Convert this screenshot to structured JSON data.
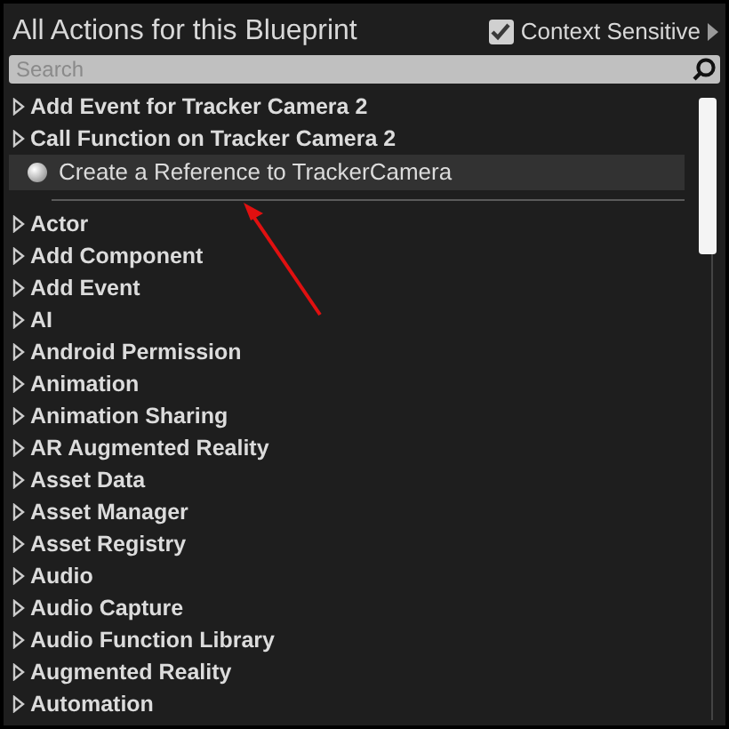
{
  "title": "All Actions for this Blueprint",
  "context_sensitive": {
    "label": "Context Sensitive",
    "checked": true
  },
  "search": {
    "placeholder": "Search"
  },
  "context_items": [
    {
      "kind": "category",
      "label": "Add Event for Tracker Camera 2",
      "selected": false
    },
    {
      "kind": "category",
      "label": "Call Function on Tracker Camera 2",
      "selected": false
    },
    {
      "kind": "action",
      "label": "Create a Reference to TrackerCamera",
      "selected": true
    }
  ],
  "categories": [
    {
      "kind": "category",
      "label": "Actor",
      "selected": false
    },
    {
      "kind": "category",
      "label": "Add Component",
      "selected": false
    },
    {
      "kind": "category",
      "label": "Add Event",
      "selected": false
    },
    {
      "kind": "category",
      "label": "AI",
      "selected": false
    },
    {
      "kind": "category",
      "label": "Android Permission",
      "selected": false
    },
    {
      "kind": "category",
      "label": "Animation",
      "selected": false
    },
    {
      "kind": "category",
      "label": "Animation Sharing",
      "selected": false
    },
    {
      "kind": "category",
      "label": "AR Augmented Reality",
      "selected": false
    },
    {
      "kind": "category",
      "label": "Asset Data",
      "selected": false
    },
    {
      "kind": "category",
      "label": "Asset Manager",
      "selected": false
    },
    {
      "kind": "category",
      "label": "Asset Registry",
      "selected": false
    },
    {
      "kind": "category",
      "label": "Audio",
      "selected": false
    },
    {
      "kind": "category",
      "label": "Audio Capture",
      "selected": false
    },
    {
      "kind": "category",
      "label": "Audio Function Library",
      "selected": false
    },
    {
      "kind": "category",
      "label": "Augmented Reality",
      "selected": false
    },
    {
      "kind": "category",
      "label": "Automation",
      "selected": false
    }
  ]
}
